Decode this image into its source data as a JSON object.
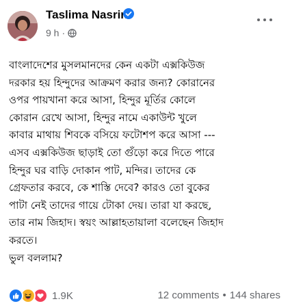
{
  "post": {
    "author": "Taslima Nasrin",
    "time": "9 h",
    "meta_separator": "·",
    "verified_icon": "verified-badge-icon",
    "privacy_icon": "globe-icon",
    "more_icon": "more-options-icon",
    "lines": [
      "বাংলাদেশের মুসলমানদের কেন একটা এক্সকিউজ",
      "দরকার হয় হিন্দুদের আক্রমণ করার জন্য? কোরানের",
      "ওপর পায়খানা করে আসা, হিন্দুর মূর্তির কোলে",
      "কোরান রেখে আসা, হিন্দুর নামে একাউন্ট খুলে",
      "কাবার মাথায় শিবকে বসিয়ে ফটোশপ করে  আসা ---",
      "এসব  এক্সকিউজ ছাড়াই তো গুঁড়ো করে দিতে পারে",
      "হিন্দুর ঘর বাড়ি দোকান পাট, মন্দির। তাদের কে",
      "গ্রেফতার করবে, কে শাস্তি দেবে? কারও তো বুকের",
      "পাটা নেই তাদের গায়ে  টোকা দেয়। তারা যা করছে,",
      "তার নাম জিহাদ। স্বয়ং আল্লাহতায়ালা বলেছেন জিহাদ",
      "করতে।",
      "ভুল বললাম?"
    ]
  },
  "footer": {
    "reactions": [
      "like",
      "haha",
      "love"
    ],
    "reaction_count": "1.9K",
    "comments": "12 comments",
    "separator": "•",
    "shares": "144 shares"
  },
  "colors": {
    "like": "#1877f2",
    "haha": "#f7b125",
    "love": "#f33e58",
    "secondary_text": "#65676b"
  }
}
